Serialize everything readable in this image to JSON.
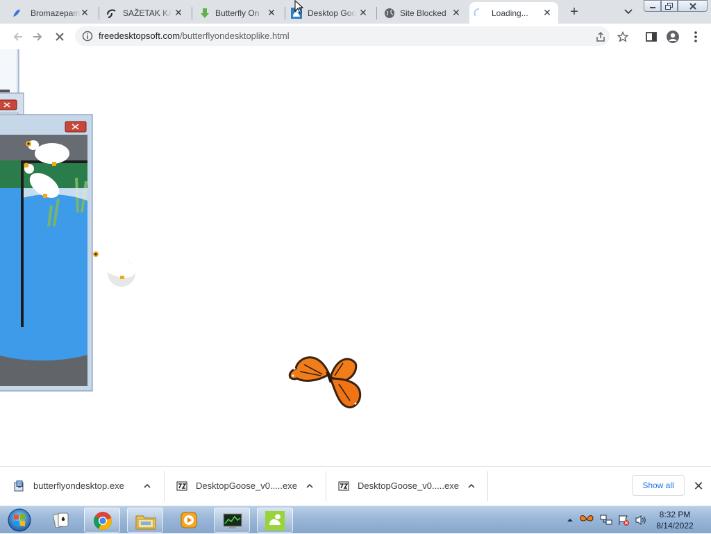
{
  "browser": {
    "tabs": [
      {
        "title": "Bromazepam",
        "icon": "bromazepam-favicon"
      },
      {
        "title": "SAŽETAK KA",
        "icon": "sazetak-favicon"
      },
      {
        "title": "Butterfly On",
        "icon": "download-arrow-favicon"
      },
      {
        "title": "Desktop Goo",
        "icon": "desktop-goose-favicon"
      },
      {
        "title": "Site Blocked",
        "icon": "globe-favicon"
      },
      {
        "title": "Loading...",
        "icon": "loading-spinner",
        "active": true
      }
    ],
    "address": {
      "host": "freedesktopsoft.com",
      "path": "/butterflyondesktoplike.html"
    }
  },
  "downloads": {
    "items": [
      {
        "name": "butterflyondesktop.exe",
        "icon": "installer-icon"
      },
      {
        "name": "DesktopGoose_v0.....exe",
        "icon": "7zip-icon"
      },
      {
        "name": "DesktopGoose_v0.....exe",
        "icon": "7zip-icon"
      }
    ],
    "show_all": "Show all"
  },
  "taskbar": {
    "apps": [
      "start-orb",
      "solitaire",
      "chrome",
      "explorer",
      "media-player",
      "task-manager",
      "desktop-goose"
    ],
    "clock": {
      "time": "8:32 PM",
      "date": "8/14/2022"
    }
  },
  "colors": {
    "tabstrip": "#dee1e6",
    "taskbar": "#9ab7d8",
    "butterfly": "#f07d1a",
    "goose_window_water": "#3d9bea"
  }
}
